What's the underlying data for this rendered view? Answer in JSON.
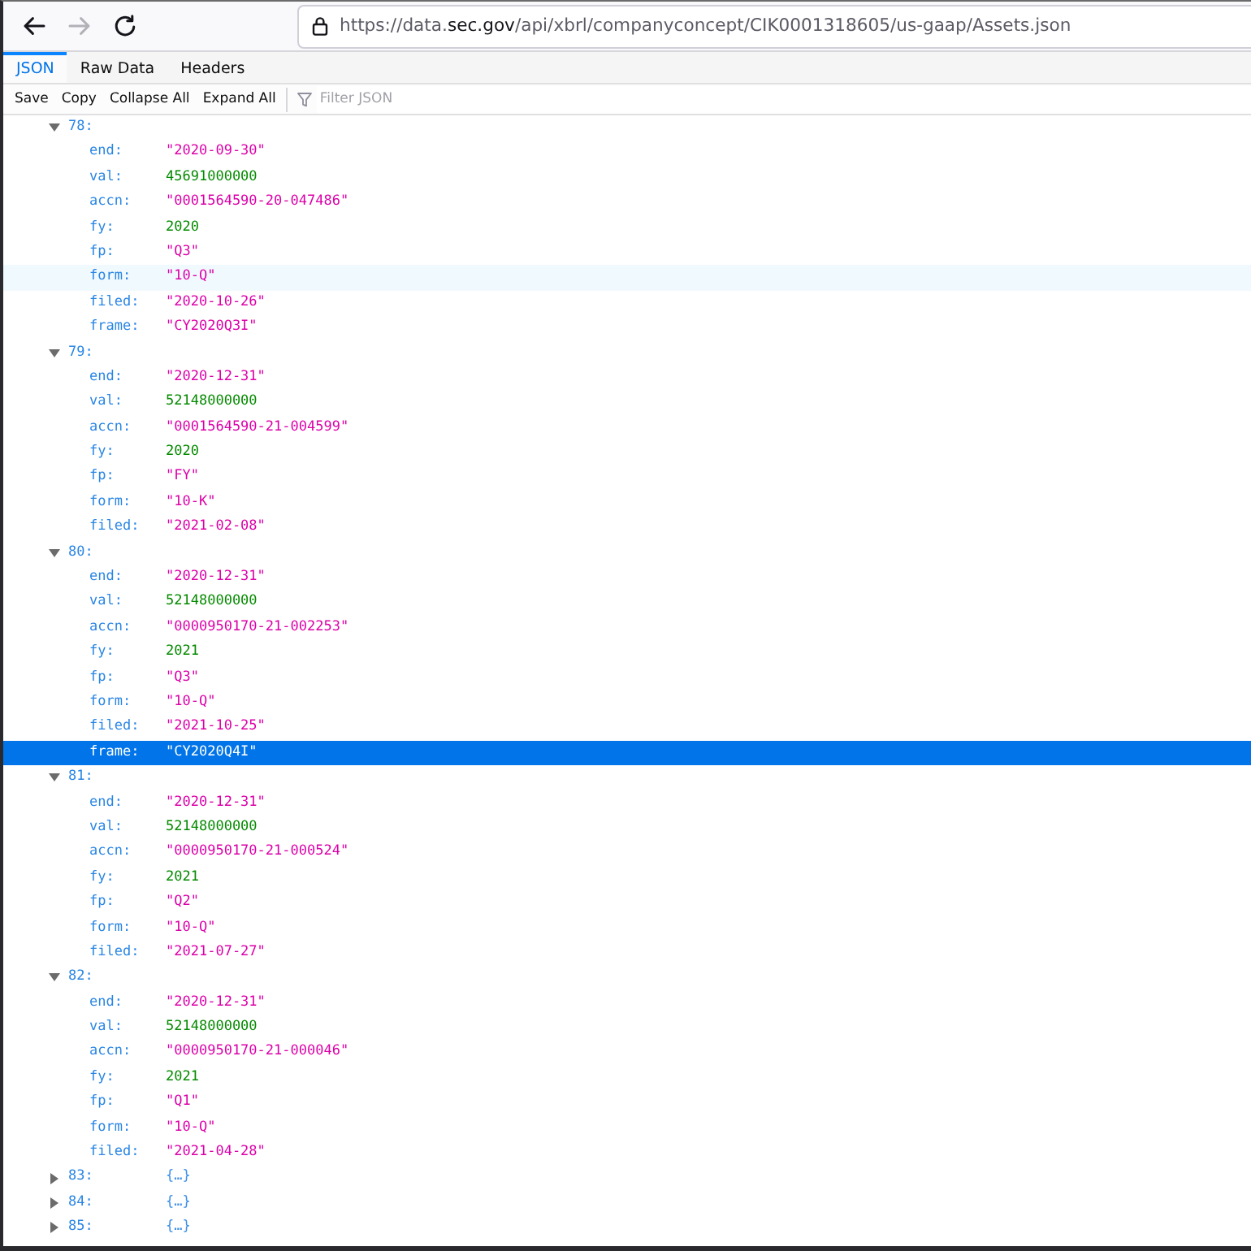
{
  "browser": {
    "nav_buttons": [
      {
        "kind": "back",
        "disabled": false
      },
      {
        "kind": "forward",
        "disabled": true
      },
      {
        "kind": "reload",
        "disabled": false
      }
    ],
    "url": {
      "prefix": "https://data.",
      "domain": "sec.gov",
      "path": "/api/xbrl/companyconcept/CIK0001318605/us-gaap/Assets.json"
    }
  },
  "tabs": [
    {
      "label": "JSON",
      "selected": true
    },
    {
      "label": "Raw Data",
      "selected": false
    },
    {
      "label": "Headers",
      "selected": false
    }
  ],
  "toolbar": {
    "buttons": [
      "Save",
      "Copy",
      "Collapse All",
      "Expand All"
    ],
    "filter": {
      "placeholder": "Filter JSON"
    }
  },
  "tree": [
    {
      "label": "78:",
      "expanded": true,
      "selected": false,
      "hovered": false,
      "children": [
        {
          "label": "end:",
          "value": "\"2020-09-30\"",
          "kind": "string",
          "selected": false,
          "hovered": false
        },
        {
          "label": "val:",
          "value": "45691000000",
          "kind": "number",
          "selected": false,
          "hovered": false
        },
        {
          "label": "accn:",
          "value": "\"0001564590-20-047486\"",
          "kind": "string",
          "selected": false,
          "hovered": false
        },
        {
          "label": "fy:",
          "value": "2020",
          "kind": "number",
          "selected": false,
          "hovered": false
        },
        {
          "label": "fp:",
          "value": "\"Q3\"",
          "kind": "string",
          "selected": false,
          "hovered": false
        },
        {
          "label": "form:",
          "value": "\"10-Q\"",
          "kind": "string",
          "selected": false,
          "hovered": true
        },
        {
          "label": "filed:",
          "value": "\"2020-10-26\"",
          "kind": "string",
          "selected": false,
          "hovered": false
        },
        {
          "label": "frame:",
          "value": "\"CY2020Q3I\"",
          "kind": "string",
          "selected": false,
          "hovered": false
        }
      ]
    },
    {
      "label": "79:",
      "expanded": true,
      "selected": false,
      "hovered": false,
      "children": [
        {
          "label": "end:",
          "value": "\"2020-12-31\"",
          "kind": "string",
          "selected": false,
          "hovered": false
        },
        {
          "label": "val:",
          "value": "52148000000",
          "kind": "number",
          "selected": false,
          "hovered": false
        },
        {
          "label": "accn:",
          "value": "\"0001564590-21-004599\"",
          "kind": "string",
          "selected": false,
          "hovered": false
        },
        {
          "label": "fy:",
          "value": "2020",
          "kind": "number",
          "selected": false,
          "hovered": false
        },
        {
          "label": "fp:",
          "value": "\"FY\"",
          "kind": "string",
          "selected": false,
          "hovered": false
        },
        {
          "label": "form:",
          "value": "\"10-K\"",
          "kind": "string",
          "selected": false,
          "hovered": false
        },
        {
          "label": "filed:",
          "value": "\"2021-02-08\"",
          "kind": "string",
          "selected": false,
          "hovered": false
        }
      ]
    },
    {
      "label": "80:",
      "expanded": true,
      "selected": false,
      "hovered": false,
      "children": [
        {
          "label": "end:",
          "value": "\"2020-12-31\"",
          "kind": "string",
          "selected": false,
          "hovered": false
        },
        {
          "label": "val:",
          "value": "52148000000",
          "kind": "number",
          "selected": false,
          "hovered": false
        },
        {
          "label": "accn:",
          "value": "\"0000950170-21-002253\"",
          "kind": "string",
          "selected": false,
          "hovered": false
        },
        {
          "label": "fy:",
          "value": "2021",
          "kind": "number",
          "selected": false,
          "hovered": false
        },
        {
          "label": "fp:",
          "value": "\"Q3\"",
          "kind": "string",
          "selected": false,
          "hovered": false
        },
        {
          "label": "form:",
          "value": "\"10-Q\"",
          "kind": "string",
          "selected": false,
          "hovered": false
        },
        {
          "label": "filed:",
          "value": "\"2021-10-25\"",
          "kind": "string",
          "selected": false,
          "hovered": false
        },
        {
          "label": "frame:",
          "value": "\"CY2020Q4I\"",
          "kind": "string",
          "selected": true,
          "hovered": false
        }
      ]
    },
    {
      "label": "81:",
      "expanded": true,
      "selected": false,
      "hovered": false,
      "children": [
        {
          "label": "end:",
          "value": "\"2020-12-31\"",
          "kind": "string",
          "selected": false,
          "hovered": false
        },
        {
          "label": "val:",
          "value": "52148000000",
          "kind": "number",
          "selected": false,
          "hovered": false
        },
        {
          "label": "accn:",
          "value": "\"0000950170-21-000524\"",
          "kind": "string",
          "selected": false,
          "hovered": false
        },
        {
          "label": "fy:",
          "value": "2021",
          "kind": "number",
          "selected": false,
          "hovered": false
        },
        {
          "label": "fp:",
          "value": "\"Q2\"",
          "kind": "string",
          "selected": false,
          "hovered": false
        },
        {
          "label": "form:",
          "value": "\"10-Q\"",
          "kind": "string",
          "selected": false,
          "hovered": false
        },
        {
          "label": "filed:",
          "value": "\"2021-07-27\"",
          "kind": "string",
          "selected": false,
          "hovered": false
        }
      ]
    },
    {
      "label": "82:",
      "expanded": true,
      "selected": false,
      "hovered": false,
      "children": [
        {
          "label": "end:",
          "value": "\"2020-12-31\"",
          "kind": "string",
          "selected": false,
          "hovered": false
        },
        {
          "label": "val:",
          "value": "52148000000",
          "kind": "number",
          "selected": false,
          "hovered": false
        },
        {
          "label": "accn:",
          "value": "\"0000950170-21-000046\"",
          "kind": "string",
          "selected": false,
          "hovered": false
        },
        {
          "label": "fy:",
          "value": "2021",
          "kind": "number",
          "selected": false,
          "hovered": false
        },
        {
          "label": "fp:",
          "value": "\"Q1\"",
          "kind": "string",
          "selected": false,
          "hovered": false
        },
        {
          "label": "form:",
          "value": "\"10-Q\"",
          "kind": "string",
          "selected": false,
          "hovered": false
        },
        {
          "label": "filed:",
          "value": "\"2021-04-28\"",
          "kind": "string",
          "selected": false,
          "hovered": false
        }
      ]
    },
    {
      "label": "83:",
      "expanded": false,
      "selected": false,
      "hovered": false,
      "summary": "{…}"
    },
    {
      "label": "84:",
      "expanded": false,
      "selected": false,
      "hovered": false,
      "summary": "{…}"
    },
    {
      "label": "85:",
      "expanded": false,
      "selected": false,
      "hovered": false,
      "summary": "{…}"
    }
  ]
}
